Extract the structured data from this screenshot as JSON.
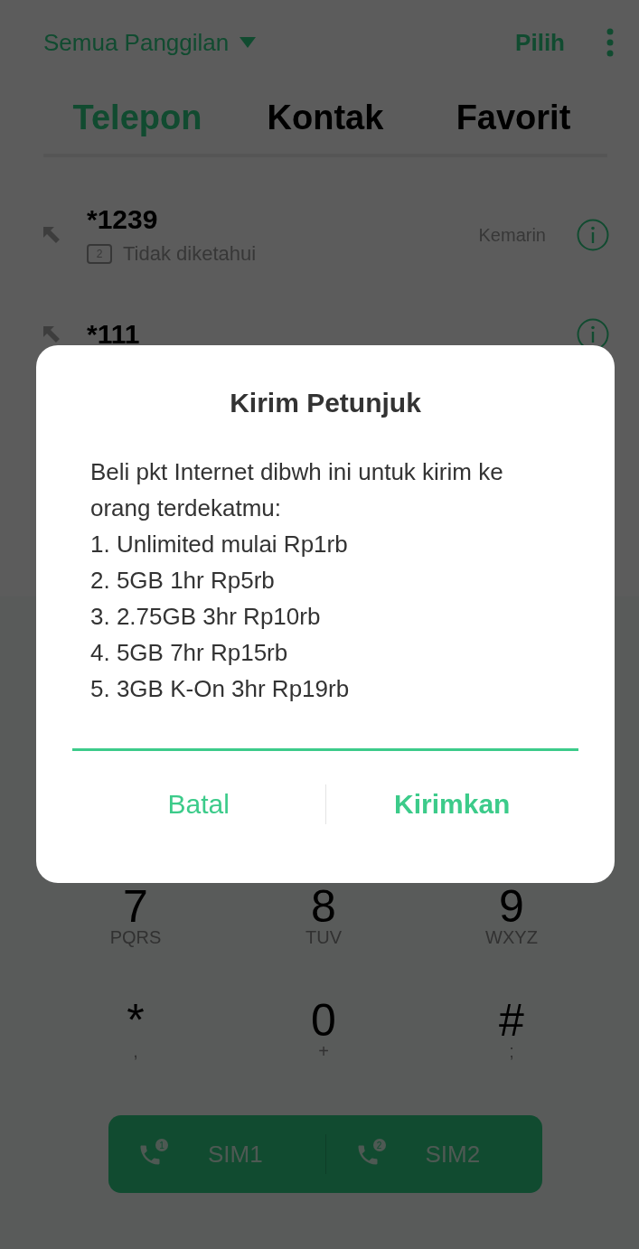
{
  "header": {
    "filter_label": "Semua Panggilan",
    "action": "Pilih"
  },
  "tabs": [
    {
      "label": "Telepon",
      "selected": true
    },
    {
      "label": "Kontak",
      "selected": false
    },
    {
      "label": "Favorit",
      "selected": false
    }
  ],
  "calls": [
    {
      "number": "*1239",
      "sim_badge": "2",
      "status": "Tidak diketahui",
      "time": "Kemarin"
    },
    {
      "number": "*111"
    }
  ],
  "keypad": [
    {
      "digit": "7",
      "letters": "PQRS"
    },
    {
      "digit": "8",
      "letters": "TUV"
    },
    {
      "digit": "9",
      "letters": "WXYZ"
    },
    {
      "digit": "*",
      "letters": ","
    },
    {
      "digit": "0",
      "letters": "+"
    },
    {
      "digit": "#",
      "letters": ";"
    }
  ],
  "sim_buttons": [
    {
      "label": "SIM1",
      "badge": "1"
    },
    {
      "label": "SIM2",
      "badge": "2"
    }
  ],
  "dialog": {
    "title": "Kirim Petunjuk",
    "intro": "Beli pkt Internet dibwh ini untuk kirim ke orang terdekatmu:",
    "lines": [
      "1. Unlimited mulai Rp1rb",
      "2. 5GB 1hr Rp5rb",
      "3. 2.75GB 3hr Rp10rb",
      "4. 5GB 7hr Rp15rb",
      "5. 3GB K-On 3hr Rp19rb"
    ],
    "input_focused": true,
    "buttons": [
      {
        "label": "Batal",
        "kind": "cancel"
      },
      {
        "label": "Kirimkan",
        "kind": "confirm"
      }
    ]
  }
}
